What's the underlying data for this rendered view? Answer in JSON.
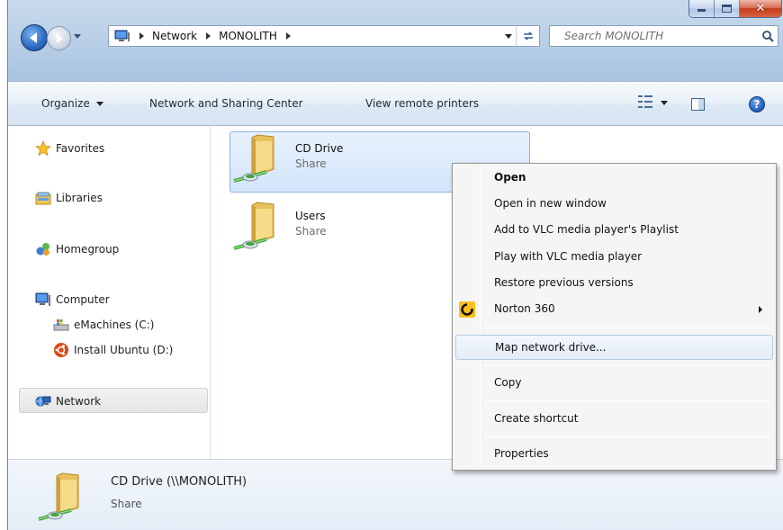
{
  "window": {
    "caption_buttons": {
      "minimize": "minimize",
      "maximize": "maximize",
      "close": "✕"
    }
  },
  "address_bar": {
    "breadcrumbs": [
      "Network",
      "MONOLITH"
    ]
  },
  "search": {
    "placeholder": "Search MONOLITH"
  },
  "command_bar": {
    "organize": "Organize",
    "network_sharing_center": "Network and Sharing Center",
    "view_remote_printers": "View remote printers",
    "help": "?"
  },
  "nav": {
    "favorites": "Favorites",
    "libraries": "Libraries",
    "homegroup": "Homegroup",
    "computer": "Computer",
    "drive_c": "eMachines (C:)",
    "drive_d": "Install Ubuntu (D:)",
    "network": "Network"
  },
  "items": [
    {
      "name": "CD Drive",
      "type": "Share"
    },
    {
      "name": "Users",
      "type": "Share"
    }
  ],
  "details": {
    "name": "CD Drive (\\\\MONOLITH)",
    "type": "Share"
  },
  "context_menu": {
    "open": "Open",
    "open_new_window": "Open in new window",
    "add_vlc_playlist": "Add to VLC media player's Playlist",
    "play_vlc": "Play with VLC media player",
    "restore_versions": "Restore previous versions",
    "norton": "Norton 360",
    "map_drive": "Map network drive...",
    "copy": "Copy",
    "create_shortcut": "Create shortcut",
    "properties": "Properties"
  },
  "colors": {
    "accent": "#2f6fc4",
    "selection": "#d3e5fa",
    "close_red": "#c23c1e",
    "share_green": "#3fa33a"
  }
}
